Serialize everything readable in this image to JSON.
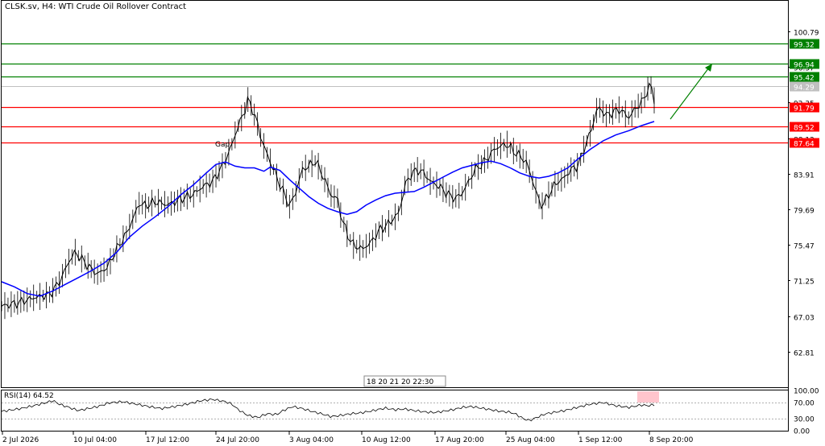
{
  "header": {
    "title": "CLSK.sv, H4:  WTI Crude Oil Rollover Contract"
  },
  "chart_data": {
    "type": "candlestick",
    "symbol": "CLSK.sv",
    "timeframe": "H4",
    "description": "WTI Crude Oil Rollover Contract",
    "ylim": [
      58.6,
      104.4
    ],
    "price_ticks": [
      "100.79",
      "96.57",
      "92.35",
      "88.13",
      "83.91",
      "79.69",
      "75.47",
      "71.25",
      "67.03",
      "62.81"
    ],
    "x_labels": [
      "2 Jul 2026",
      "10 Jul 04:00",
      "17 Jul 12:00",
      "24 Jul 20:00",
      "3 Aug 04:00",
      "10 Aug 12:00",
      "17 Aug 20:00",
      "25 Aug 04:00",
      "1 Sep 12:00",
      "8 Sep 20:00"
    ],
    "current_price": "94.29",
    "resistance_levels": [
      {
        "label": "99.32",
        "value": 99.32,
        "color": "#008000"
      },
      {
        "label": "96.94",
        "value": 96.94,
        "color": "#008000"
      },
      {
        "label": "95.42",
        "value": 95.42,
        "color": "#008000"
      }
    ],
    "support_levels": [
      {
        "label": "91.79",
        "value": 91.79,
        "color": "#ff0000"
      },
      {
        "label": "89.52",
        "value": 89.52,
        "color": "#ff0000"
      },
      {
        "label": "87.64",
        "value": 87.64,
        "color": "#ff0000"
      }
    ],
    "annotations": [
      {
        "text": "Gap"
      }
    ],
    "scroll_label": "18 20 21 20 22:30",
    "price_path": [
      [
        0,
        68.2
      ],
      [
        5,
        68.6
      ],
      [
        10,
        69.2
      ],
      [
        15,
        69.6
      ],
      [
        18,
        71.0
      ],
      [
        21,
        73.5
      ],
      [
        23,
        74.6
      ],
      [
        25,
        73.8
      ],
      [
        28,
        72.6
      ],
      [
        30,
        72.0
      ],
      [
        33,
        72.8
      ],
      [
        36,
        75.0
      ],
      [
        39,
        76.8
      ],
      [
        41,
        78.5
      ],
      [
        43,
        80.4
      ],
      [
        45,
        80.1
      ],
      [
        48,
        80.6
      ],
      [
        52,
        80.2
      ],
      [
        56,
        80.9
      ],
      [
        60,
        81.5
      ],
      [
        63,
        82.4
      ],
      [
        66,
        83.0
      ],
      [
        68,
        84.2
      ],
      [
        70,
        85.5
      ],
      [
        72,
        87.4
      ],
      [
        74,
        89.6
      ],
      [
        76,
        91.4
      ],
      [
        77,
        92.7
      ],
      [
        78,
        92.0
      ],
      [
        80,
        89.8
      ],
      [
        81,
        88.2
      ],
      [
        83,
        86.2
      ],
      [
        85,
        84.4
      ],
      [
        87,
        82.6
      ],
      [
        89,
        81.0
      ],
      [
        90,
        80.0
      ],
      [
        92,
        81.8
      ],
      [
        94,
        84.4
      ],
      [
        96,
        84.8
      ],
      [
        98,
        85.4
      ],
      [
        99,
        84.8
      ],
      [
        101,
        83.2
      ],
      [
        103,
        81.3
      ],
      [
        105,
        81.0
      ],
      [
        106,
        79.0
      ],
      [
        108,
        76.8
      ],
      [
        110,
        75.4
      ],
      [
        113,
        75.0
      ],
      [
        116,
        76.0
      ],
      [
        118,
        77.2
      ],
      [
        121,
        78.0
      ],
      [
        124,
        79.2
      ],
      [
        125,
        80.5
      ],
      [
        126,
        82.5
      ],
      [
        128,
        83.8
      ],
      [
        130,
        84.4
      ],
      [
        132,
        84.0
      ],
      [
        134,
        83.0
      ],
      [
        136,
        82.6
      ],
      [
        138,
        82.0
      ],
      [
        140,
        81.3
      ],
      [
        142,
        81.0
      ],
      [
        144,
        81.6
      ],
      [
        146,
        83.0
      ],
      [
        148,
        84.4
      ],
      [
        150,
        85.0
      ],
      [
        152,
        85.8
      ],
      [
        154,
        86.8
      ],
      [
        156,
        87.2
      ],
      [
        158,
        87.4
      ],
      [
        160,
        86.6
      ],
      [
        162,
        86.0
      ],
      [
        164,
        85.3
      ],
      [
        165,
        84.2
      ],
      [
        166,
        83.1
      ],
      [
        167,
        81.9
      ],
      [
        168,
        80.6
      ],
      [
        169,
        80.1
      ],
      [
        171,
        81.4
      ],
      [
        173,
        82.7
      ],
      [
        175,
        83.2
      ],
      [
        176,
        83.5
      ],
      [
        178,
        84.4
      ],
      [
        180,
        84.8
      ],
      [
        181,
        85.6
      ],
      [
        182,
        86.8
      ],
      [
        183,
        87.8
      ],
      [
        184,
        88.7
      ],
      [
        185,
        90.0
      ],
      [
        186,
        91.4
      ],
      [
        187,
        91.7
      ],
      [
        189,
        90.8
      ],
      [
        191,
        91.2
      ],
      [
        193,
        91.5
      ],
      [
        195,
        91.0
      ],
      [
        196,
        90.5
      ],
      [
        198,
        91.6
      ],
      [
        200,
        92.3
      ],
      [
        201,
        93.0
      ],
      [
        202,
        94.0
      ],
      [
        203,
        94.4
      ],
      [
        204,
        92.6
      ]
    ],
    "ma_path": [
      [
        0,
        71.1
      ],
      [
        4,
        70.5
      ],
      [
        8,
        69.7
      ],
      [
        12,
        69.4
      ],
      [
        16,
        70.0
      ],
      [
        20,
        70.8
      ],
      [
        24,
        71.6
      ],
      [
        28,
        72.4
      ],
      [
        32,
        73.3
      ],
      [
        36,
        74.6
      ],
      [
        40,
        76.4
      ],
      [
        44,
        77.7
      ],
      [
        48,
        78.8
      ],
      [
        52,
        80.0
      ],
      [
        56,
        81.4
      ],
      [
        60,
        82.6
      ],
      [
        64,
        84.0
      ],
      [
        67,
        85.0
      ],
      [
        70,
        85.3
      ],
      [
        73,
        84.8
      ],
      [
        76,
        84.6
      ],
      [
        79,
        84.6
      ],
      [
        82,
        84.2
      ],
      [
        84,
        84.7
      ],
      [
        87,
        84.3
      ],
      [
        90,
        83.2
      ],
      [
        93,
        82.2
      ],
      [
        96,
        81.2
      ],
      [
        99,
        80.4
      ],
      [
        102,
        79.8
      ],
      [
        105,
        79.4
      ],
      [
        108,
        79.1
      ],
      [
        111,
        79.4
      ],
      [
        114,
        80.2
      ],
      [
        117,
        80.8
      ],
      [
        120,
        81.3
      ],
      [
        123,
        81.6
      ],
      [
        126,
        81.7
      ],
      [
        129,
        81.8
      ],
      [
        132,
        82.3
      ],
      [
        135,
        82.9
      ],
      [
        138,
        83.5
      ],
      [
        141,
        84.1
      ],
      [
        144,
        84.6
      ],
      [
        147,
        84.9
      ],
      [
        150,
        85.2
      ],
      [
        153,
        85.4
      ],
      [
        156,
        85.1
      ],
      [
        159,
        84.6
      ],
      [
        162,
        84.0
      ],
      [
        165,
        83.6
      ],
      [
        168,
        83.4
      ],
      [
        171,
        83.6
      ],
      [
        174,
        84.0
      ],
      [
        177,
        84.6
      ],
      [
        180,
        85.6
      ],
      [
        184,
        86.8
      ],
      [
        188,
        87.8
      ],
      [
        192,
        88.5
      ],
      [
        196,
        89.0
      ],
      [
        200,
        89.6
      ],
      [
        204,
        90.1
      ]
    ],
    "rsi": {
      "label": "RSI(14) 64.52",
      "period": 14,
      "value": 64.52,
      "ylim": [
        0,
        100
      ],
      "ticks": [
        "100.00",
        "70.00",
        "30.00",
        "0.00"
      ],
      "path": [
        [
          0,
          48
        ],
        [
          6,
          55
        ],
        [
          10,
          62
        ],
        [
          14,
          70
        ],
        [
          16,
          75
        ],
        [
          18,
          66
        ],
        [
          21,
          58
        ],
        [
          24,
          50
        ],
        [
          27,
          55
        ],
        [
          30,
          60
        ],
        [
          34,
          70
        ],
        [
          38,
          72
        ],
        [
          42,
          66
        ],
        [
          46,
          60
        ],
        [
          50,
          55
        ],
        [
          54,
          60
        ],
        [
          58,
          66
        ],
        [
          62,
          74
        ],
        [
          66,
          78
        ],
        [
          70,
          72
        ],
        [
          72,
          66
        ],
        [
          74,
          52
        ],
        [
          77,
          38
        ],
        [
          80,
          33
        ],
        [
          83,
          42
        ],
        [
          86,
          40
        ],
        [
          88,
          50
        ],
        [
          91,
          60
        ],
        [
          94,
          55
        ],
        [
          97,
          48
        ],
        [
          100,
          42
        ],
        [
          103,
          35
        ],
        [
          106,
          38
        ],
        [
          109,
          42
        ],
        [
          112,
          44
        ],
        [
          115,
          48
        ],
        [
          118,
          53
        ],
        [
          120,
          56
        ],
        [
          123,
          52
        ],
        [
          126,
          54
        ],
        [
          129,
          50
        ],
        [
          132,
          47
        ],
        [
          135,
          45
        ],
        [
          138,
          48
        ],
        [
          141,
          52
        ],
        [
          144,
          58
        ],
        [
          147,
          60
        ],
        [
          150,
          56
        ],
        [
          153,
          52
        ],
        [
          156,
          48
        ],
        [
          159,
          46
        ],
        [
          161,
          40
        ],
        [
          163,
          30
        ],
        [
          165,
          25
        ],
        [
          167,
          32
        ],
        [
          170,
          42
        ],
        [
          173,
          46
        ],
        [
          176,
          50
        ],
        [
          180,
          58
        ],
        [
          184,
          66
        ],
        [
          188,
          70
        ],
        [
          192,
          62
        ],
        [
          196,
          58
        ],
        [
          200,
          64
        ],
        [
          202,
          62
        ],
        [
          204,
          64.5
        ]
      ]
    }
  }
}
